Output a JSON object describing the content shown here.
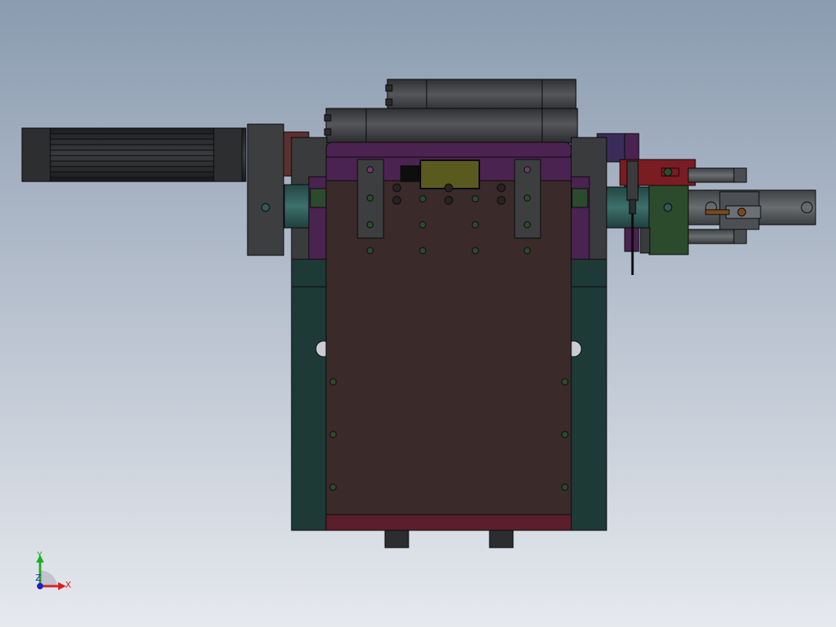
{
  "viewport": {
    "background_top": "#8b9bb0",
    "background_bottom": "#e6e9ee"
  },
  "colors": {
    "base_plate": "#3a2a2a",
    "side_block": "#1e3a36",
    "purple": "#4a2350",
    "dark_red": "#5a1f2a",
    "grey_metal": "#48494b",
    "dark_metal": "#2b2d2f",
    "red_bracket": "#7a1c22",
    "green_bracket": "#2c4a2c",
    "teal_rod": "#2f5a57",
    "lcd": "#5a5a1e",
    "line": "#0a0a0a"
  },
  "triad": {
    "x_label": "X",
    "y_label": "Y",
    "z_label": "Z",
    "x_color": "#d62020",
    "y_color": "#1eb01e",
    "z_color": "#1e1ec8"
  },
  "icons": {
    "axis_triad": "coordinate-triad-icon"
  }
}
